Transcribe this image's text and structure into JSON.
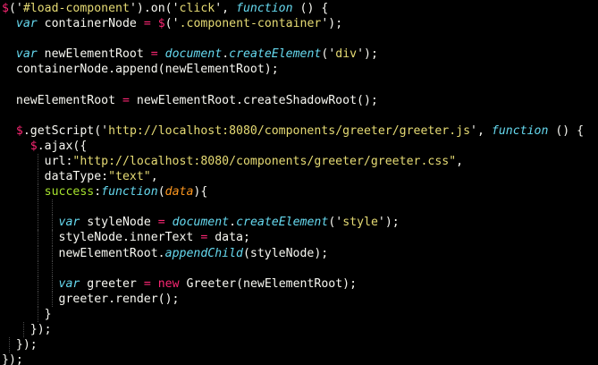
{
  "editor": {
    "background": "#000000",
    "colors": {
      "keyword": "#f92672",
      "string": "#e6db74",
      "storage": "#66d9ef",
      "function": "#a6e22e",
      "parameter": "#fd971f",
      "plain": "#f8f8f2"
    },
    "lines": [
      {
        "guides": [],
        "tokens": [
          {
            "t": "$",
            "c": "tok-kw"
          },
          {
            "t": "('",
            "c": "tok-plain"
          },
          {
            "t": "#load-component",
            "c": "tok-str"
          },
          {
            "t": "').on('",
            "c": "tok-plain"
          },
          {
            "t": "click",
            "c": "tok-str"
          },
          {
            "t": "', ",
            "c": "tok-plain"
          },
          {
            "t": "function",
            "c": "tok-storage"
          },
          {
            "t": " () {",
            "c": "tok-plain"
          }
        ]
      },
      {
        "guides": [],
        "tokens": [
          {
            "t": "  ",
            "c": "tok-plain"
          },
          {
            "t": "var",
            "c": "tok-storage"
          },
          {
            "t": " containerNode ",
            "c": "tok-plain"
          },
          {
            "t": "=",
            "c": "tok-op"
          },
          {
            "t": " ",
            "c": "tok-plain"
          },
          {
            "t": "$",
            "c": "tok-kw"
          },
          {
            "t": "('",
            "c": "tok-plain"
          },
          {
            "t": ".component-container",
            "c": "tok-str"
          },
          {
            "t": "');",
            "c": "tok-plain"
          }
        ]
      },
      {
        "guides": [],
        "tokens": []
      },
      {
        "guides": [],
        "tokens": [
          {
            "t": "  ",
            "c": "tok-plain"
          },
          {
            "t": "var",
            "c": "tok-storage"
          },
          {
            "t": " newElementRoot ",
            "c": "tok-plain"
          },
          {
            "t": "=",
            "c": "tok-op"
          },
          {
            "t": " ",
            "c": "tok-plain"
          },
          {
            "t": "document",
            "c": "tok-fn-obj"
          },
          {
            "t": ".",
            "c": "tok-plain"
          },
          {
            "t": "createElement",
            "c": "tok-fn-obj"
          },
          {
            "t": "('",
            "c": "tok-plain"
          },
          {
            "t": "div",
            "c": "tok-str"
          },
          {
            "t": "');",
            "c": "tok-plain"
          }
        ]
      },
      {
        "guides": [],
        "tokens": [
          {
            "t": "  containerNode.append(newElementRoot);",
            "c": "tok-plain"
          }
        ]
      },
      {
        "guides": [],
        "tokens": []
      },
      {
        "guides": [],
        "tokens": [
          {
            "t": "  newElementRoot ",
            "c": "tok-plain"
          },
          {
            "t": "=",
            "c": "tok-op"
          },
          {
            "t": " newElementRoot.createShadowRoot();",
            "c": "tok-plain"
          }
        ]
      },
      {
        "guides": [],
        "tokens": []
      },
      {
        "guides": [],
        "tokens": [
          {
            "t": "  ",
            "c": "tok-plain"
          },
          {
            "t": "$",
            "c": "tok-kw"
          },
          {
            "t": ".getScript('",
            "c": "tok-plain"
          },
          {
            "t": "http://localhost:8080/components/greeter/greeter.js",
            "c": "tok-str"
          },
          {
            "t": "', ",
            "c": "tok-plain"
          },
          {
            "t": "function",
            "c": "tok-storage"
          },
          {
            "t": " () {",
            "c": "tok-plain"
          }
        ]
      },
      {
        "guides": [],
        "tokens": [
          {
            "t": "    ",
            "c": "tok-plain"
          },
          {
            "t": "$",
            "c": "tok-kw"
          },
          {
            "t": ".ajax({",
            "c": "tok-plain"
          }
        ]
      },
      {
        "guides": [
          5
        ],
        "tokens": [
          {
            "t": "      url:",
            "c": "tok-plain"
          },
          {
            "t": "\"http://localhost:8080/components/greeter/greeter.css\"",
            "c": "tok-str"
          },
          {
            "t": ",",
            "c": "tok-plain"
          }
        ]
      },
      {
        "guides": [
          5
        ],
        "tokens": [
          {
            "t": "      dataType:",
            "c": "tok-plain"
          },
          {
            "t": "\"text\"",
            "c": "tok-str"
          },
          {
            "t": ",",
            "c": "tok-plain"
          }
        ]
      },
      {
        "guides": [
          5
        ],
        "tokens": [
          {
            "t": "      ",
            "c": "tok-plain"
          },
          {
            "t": "success",
            "c": "tok-func"
          },
          {
            "t": ":",
            "c": "tok-plain"
          },
          {
            "t": "function",
            "c": "tok-storage"
          },
          {
            "t": "(",
            "c": "tok-plain"
          },
          {
            "t": "data",
            "c": "tok-param"
          },
          {
            "t": "){",
            "c": "tok-plain"
          }
        ]
      },
      {
        "guides": [
          5,
          7
        ],
        "tokens": []
      },
      {
        "guides": [
          5,
          7
        ],
        "tokens": [
          {
            "t": "        ",
            "c": "tok-plain"
          },
          {
            "t": "var",
            "c": "tok-storage"
          },
          {
            "t": " styleNode ",
            "c": "tok-plain"
          },
          {
            "t": "=",
            "c": "tok-op"
          },
          {
            "t": " ",
            "c": "tok-plain"
          },
          {
            "t": "document",
            "c": "tok-fn-obj"
          },
          {
            "t": ".",
            "c": "tok-plain"
          },
          {
            "t": "createElement",
            "c": "tok-fn-obj"
          },
          {
            "t": "('",
            "c": "tok-plain"
          },
          {
            "t": "style",
            "c": "tok-str"
          },
          {
            "t": "');",
            "c": "tok-plain"
          }
        ]
      },
      {
        "guides": [
          5,
          7
        ],
        "tokens": [
          {
            "t": "        styleNode.innerText ",
            "c": "tok-plain"
          },
          {
            "t": "=",
            "c": "tok-op"
          },
          {
            "t": " data;",
            "c": "tok-plain"
          }
        ]
      },
      {
        "guides": [
          5,
          7
        ],
        "tokens": [
          {
            "t": "        newElementRoot.",
            "c": "tok-plain"
          },
          {
            "t": "appendChild",
            "c": "tok-fn-obj"
          },
          {
            "t": "(styleNode);",
            "c": "tok-plain"
          }
        ]
      },
      {
        "guides": [
          5,
          7
        ],
        "tokens": []
      },
      {
        "guides": [
          5,
          7
        ],
        "tokens": [
          {
            "t": "        ",
            "c": "tok-plain"
          },
          {
            "t": "var",
            "c": "tok-storage"
          },
          {
            "t": " greeter ",
            "c": "tok-plain"
          },
          {
            "t": "=",
            "c": "tok-op"
          },
          {
            "t": " ",
            "c": "tok-plain"
          },
          {
            "t": "new",
            "c": "tok-kw"
          },
          {
            "t": " Greeter(newElementRoot);",
            "c": "tok-plain"
          }
        ]
      },
      {
        "guides": [
          5,
          7
        ],
        "tokens": [
          {
            "t": "        greeter.render();",
            "c": "tok-plain"
          }
        ]
      },
      {
        "guides": [
          5
        ],
        "tokens": [
          {
            "t": "      }",
            "c": "tok-plain"
          }
        ]
      },
      {
        "guides": [
          3
        ],
        "tokens": [
          {
            "t": "    });",
            "c": "tok-plain"
          }
        ]
      },
      {
        "guides": [
          1
        ],
        "tokens": [
          {
            "t": "  });",
            "c": "tok-plain"
          }
        ]
      },
      {
        "guides": [],
        "tokens": [
          {
            "t": "});",
            "c": "tok-plain"
          }
        ]
      }
    ]
  }
}
